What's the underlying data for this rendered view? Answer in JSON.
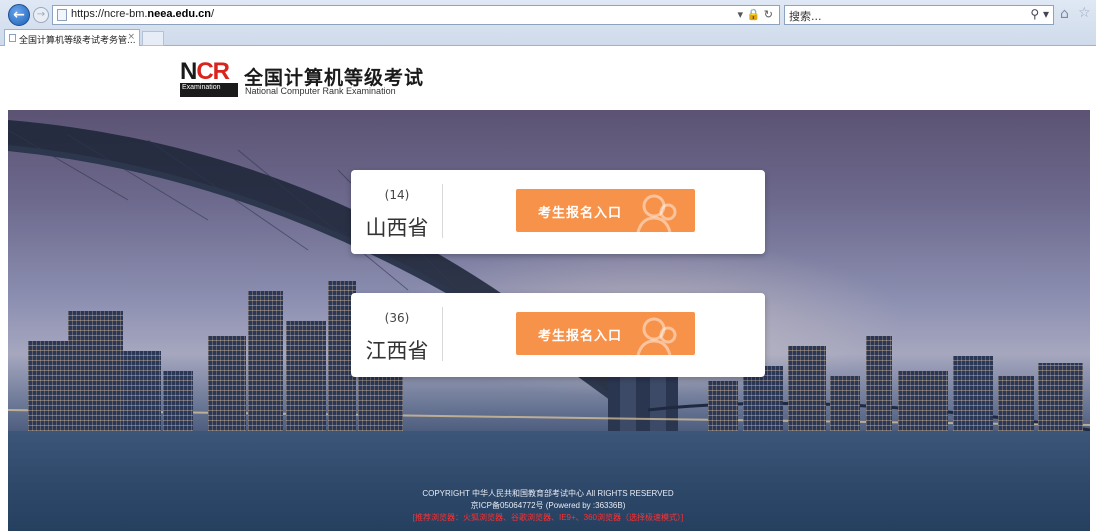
{
  "browser": {
    "url_prefix": "https://ncre-bm.",
    "url_domain": "neea.edu.cn",
    "url_suffix": "/",
    "search_placeholder": "搜索...",
    "tab_title": "全国计算机等级考试考务管...",
    "tab_close": "×"
  },
  "header": {
    "logo_text_n": "N",
    "logo_text_cr": "CR",
    "logo_bar": "Examination",
    "title": "全国计算机等级考试",
    "subtitle": "National Computer Rank Examination"
  },
  "provinces": [
    {
      "code": "(14)",
      "name": "山西省",
      "button_label": "考生报名入口"
    },
    {
      "code": "(36)",
      "name": "江西省",
      "button_label": "考生报名入口"
    }
  ],
  "footer": {
    "copyright": "COPYRIGHT 中华人民共和国教育部考试中心 All RIGHTS RESERVED",
    "icp": "京ICP备05064772号 (Powered by :36336B)",
    "browser_note": "[推荐浏览器：火狐浏览器、谷歌浏览器、IE9+、360浏览器（选择极速模式）]"
  },
  "colors": {
    "accent": "#f7924a",
    "logo_red": "#d8241c"
  }
}
